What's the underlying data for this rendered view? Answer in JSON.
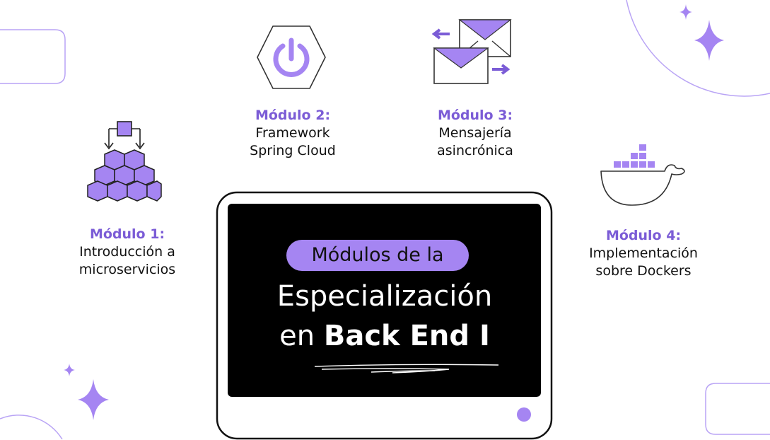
{
  "modules": [
    {
      "title": "Módulo 1:",
      "desc_line1": "Introducción a",
      "desc_line2": "microservicios",
      "icon": "cubes-icon"
    },
    {
      "title": "Módulo 2:",
      "desc_line1": "Framework",
      "desc_line2": "Spring Cloud",
      "icon": "power-icon"
    },
    {
      "title": "Módulo 3:",
      "desc_line1": "Mensajería",
      "desc_line2": "asincrónica",
      "icon": "envelopes-icon"
    },
    {
      "title": "Módulo 4:",
      "desc_line1": "Implementación",
      "desc_line2": "sobre Dockers",
      "icon": "docker-whale-icon"
    }
  ],
  "screen": {
    "pill": "Módulos de la",
    "line1": "Especialización",
    "line2_prefix": "en",
    "line2_bold": "Back End I"
  },
  "colors": {
    "accent": "#a585f2",
    "title": "#7b5cd6",
    "screen": "#000000"
  }
}
